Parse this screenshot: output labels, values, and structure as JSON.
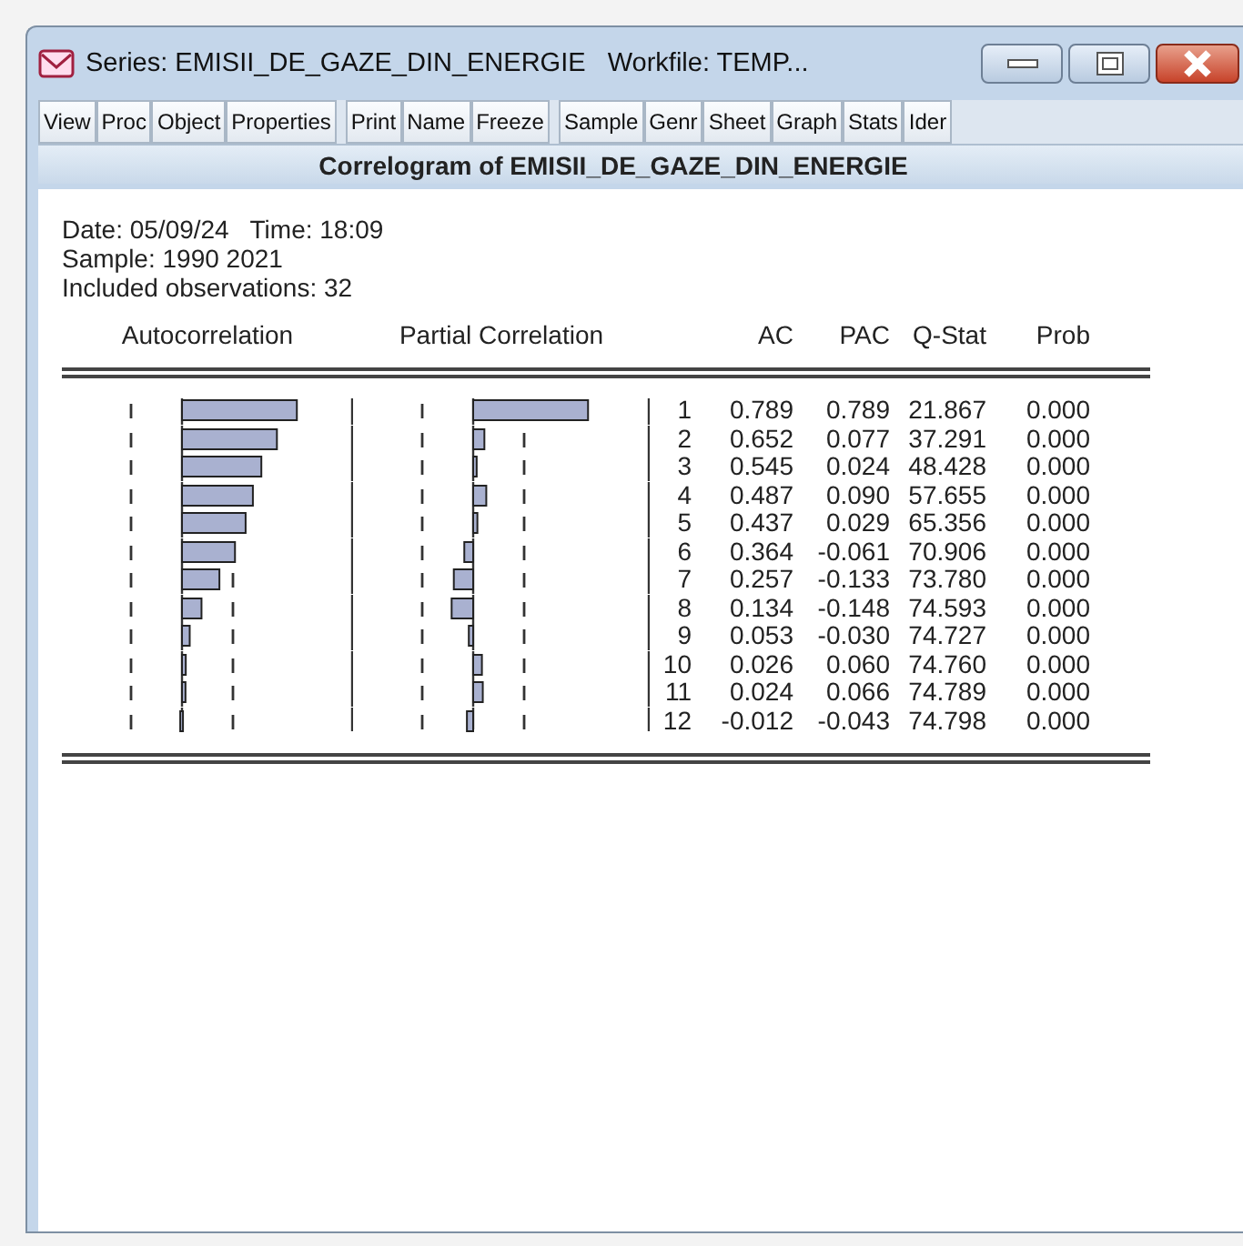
{
  "window": {
    "title": "Series: EMISII_DE_GAZE_DIN_ENERGIE   Workfile: TEMP..."
  },
  "toolbar": [
    [
      "View",
      "Proc",
      "Object",
      "Properties"
    ],
    [
      "Print",
      "Name",
      "Freeze"
    ],
    [
      "Sample",
      "Genr",
      "Sheet",
      "Graph",
      "Stats",
      "Ider"
    ]
  ],
  "heading": "Correlogram of EMISII_DE_GAZE_DIN_ENERGIE",
  "info": [
    "Date: 05/09/24   Time: 18:09",
    "Sample: 1990 2021",
    "Included observations: 32"
  ],
  "columns": [
    "Autocorrelation",
    "Partial Correlation",
    "AC",
    "PAC",
    "Q-Stat",
    "Prob"
  ],
  "rows": [
    {
      "lag": "1",
      "ac": "0.789",
      "pac": "0.789",
      "q": "21.867",
      "prob": "0.000"
    },
    {
      "lag": "2",
      "ac": "0.652",
      "pac": "0.077",
      "q": "37.291",
      "prob": "0.000"
    },
    {
      "lag": "3",
      "ac": "0.545",
      "pac": "0.024",
      "q": "48.428",
      "prob": "0.000"
    },
    {
      "lag": "4",
      "ac": "0.487",
      "pac": "0.090",
      "q": "57.655",
      "prob": "0.000"
    },
    {
      "lag": "5",
      "ac": "0.437",
      "pac": "0.029",
      "q": "65.356",
      "prob": "0.000"
    },
    {
      "lag": "6",
      "ac": "0.364",
      "pac": "-0.061",
      "q": "70.906",
      "prob": "0.000"
    },
    {
      "lag": "7",
      "ac": "0.257",
      "pac": "-0.133",
      "q": "73.780",
      "prob": "0.000"
    },
    {
      "lag": "8",
      "ac": "0.134",
      "pac": "-0.148",
      "q": "74.593",
      "prob": "0.000"
    },
    {
      "lag": "9",
      "ac": "0.053",
      "pac": "-0.030",
      "q": "74.727",
      "prob": "0.000"
    },
    {
      "lag": "10",
      "ac": "0.026",
      "pac": "0.060",
      "q": "74.760",
      "prob": "0.000"
    },
    {
      "lag": "11",
      "ac": "0.024",
      "pac": "0.066",
      "q": "74.789",
      "prob": "0.000"
    },
    {
      "lag": "12",
      "ac": "-0.012",
      "pac": "-0.043",
      "q": "74.798",
      "prob": "0.000"
    }
  ]
}
